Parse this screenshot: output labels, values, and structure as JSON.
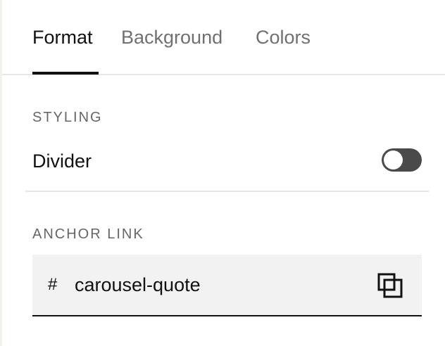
{
  "tabs": [
    {
      "label": "Format",
      "active": true
    },
    {
      "label": "Background",
      "active": false
    },
    {
      "label": "Colors",
      "active": false
    }
  ],
  "styling": {
    "section_label": "STYLING",
    "divider_label": "Divider",
    "divider_enabled": false
  },
  "anchor_link": {
    "section_label": "ANCHOR LINK",
    "prefix": "#",
    "value": "carousel-quote",
    "copy_icon": "copy-icon"
  },
  "colors": {
    "text_primary": "#111111",
    "text_secondary": "#707070",
    "toggle_off": "#4a4a4a",
    "field_bg": "#f2f2f2"
  }
}
